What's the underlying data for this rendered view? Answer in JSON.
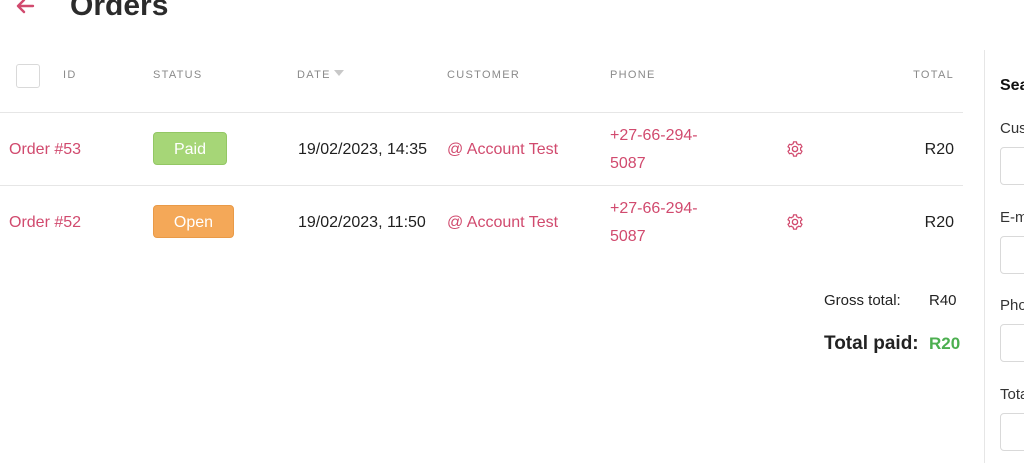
{
  "header": {
    "title": "Orders"
  },
  "table": {
    "columns": {
      "id": "ID",
      "status": "STATUS",
      "date": "DATE",
      "customer": "CUSTOMER",
      "phone": "PHONE",
      "total": "TOTAL"
    },
    "rows": [
      {
        "order": "Order #53",
        "status": "Paid",
        "date": "19/02/2023, 14:35",
        "customer": "@ Account Test",
        "phone_line1": "+27-66-294-",
        "phone_line2": "5087",
        "total": "R20"
      },
      {
        "order": "Order #52",
        "status": "Open",
        "date": "19/02/2023, 11:50",
        "customer": "@ Account Test",
        "phone_line1": "+27-66-294-",
        "phone_line2": "5087",
        "total": "R20"
      }
    ]
  },
  "totals": {
    "gross_label": "Gross total:",
    "gross_value": "R40",
    "paid_label": "Total paid:",
    "paid_value": "R20"
  },
  "search_panel": {
    "title": "Sea",
    "fields": [
      {
        "label": "Cus"
      },
      {
        "label": "E-m"
      },
      {
        "label": "Pho"
      },
      {
        "label": "Tota"
      }
    ]
  },
  "colors": {
    "accent": "#d14a6e",
    "paid_badge": "#a6d677",
    "open_badge": "#f4a858",
    "paid_total": "#4caf50"
  }
}
